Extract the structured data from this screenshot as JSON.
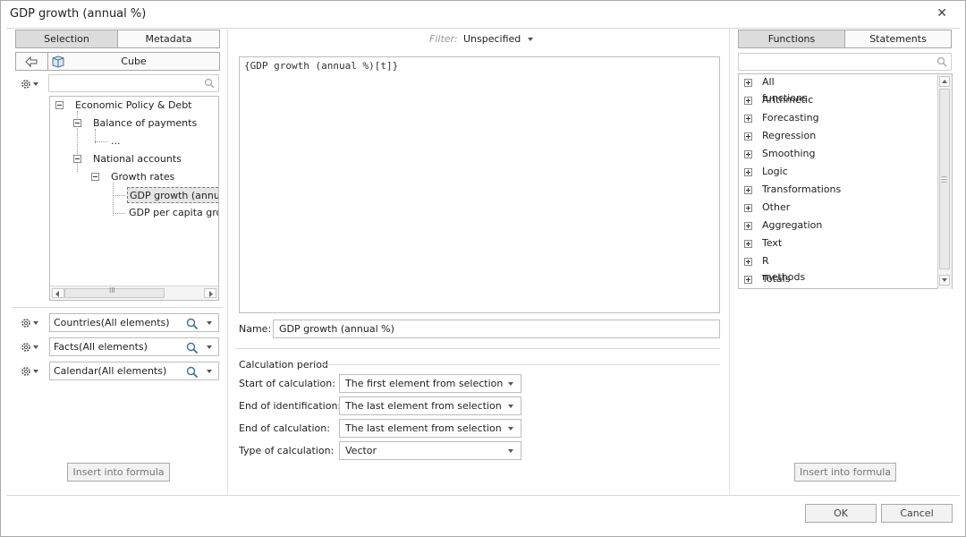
{
  "window": {
    "title": "GDP growth (annual %)"
  },
  "left_panel": {
    "tabs": [
      "Selection",
      "Metadata"
    ],
    "nav_label": "Cube",
    "tree": [
      "Economic Policy & Debt",
      "Balance of payments",
      "...",
      "National accounts",
      "Growth rates",
      "GDP growth (annual",
      "GDP per capita grow"
    ],
    "dimensions": [
      "Countries(All elements)",
      "Facts(All elements)",
      "Calendar(All elements)"
    ],
    "insert_label": "Insert into formula"
  },
  "center_panel": {
    "filter_label": "Filter:",
    "filter_value": "Unspecified",
    "formula": "{GDP growth (annual %)[t]}",
    "name_label": "Name:",
    "name_value": "GDP growth (annual %)",
    "period_title": "Calculation period",
    "rows": [
      {
        "label": "Start of calculation:",
        "value": "The first element from selection"
      },
      {
        "label": "End of identification:",
        "value": "The last element from selection"
      },
      {
        "label": "End of calculation:",
        "value": "The last element from selection"
      },
      {
        "label": "Type of calculation:",
        "value": "Vector"
      }
    ]
  },
  "right_panel": {
    "tabs": [
      "Functions",
      "Statements"
    ],
    "functions": [
      "All functions",
      "Arithmetic",
      "Forecasting",
      "Regression",
      "Smoothing",
      "Logic",
      "Transformations",
      "Other",
      "Aggregation",
      "Text",
      "R methods",
      "Totals"
    ],
    "insert_label": "Insert into formula"
  },
  "footer": {
    "ok": "OK",
    "cancel": "Cancel"
  },
  "icons": {
    "close": "close-icon",
    "back": "back-arrow-icon",
    "cube": "cube-icon",
    "search": "search-icon",
    "settings": "gear-icon"
  }
}
